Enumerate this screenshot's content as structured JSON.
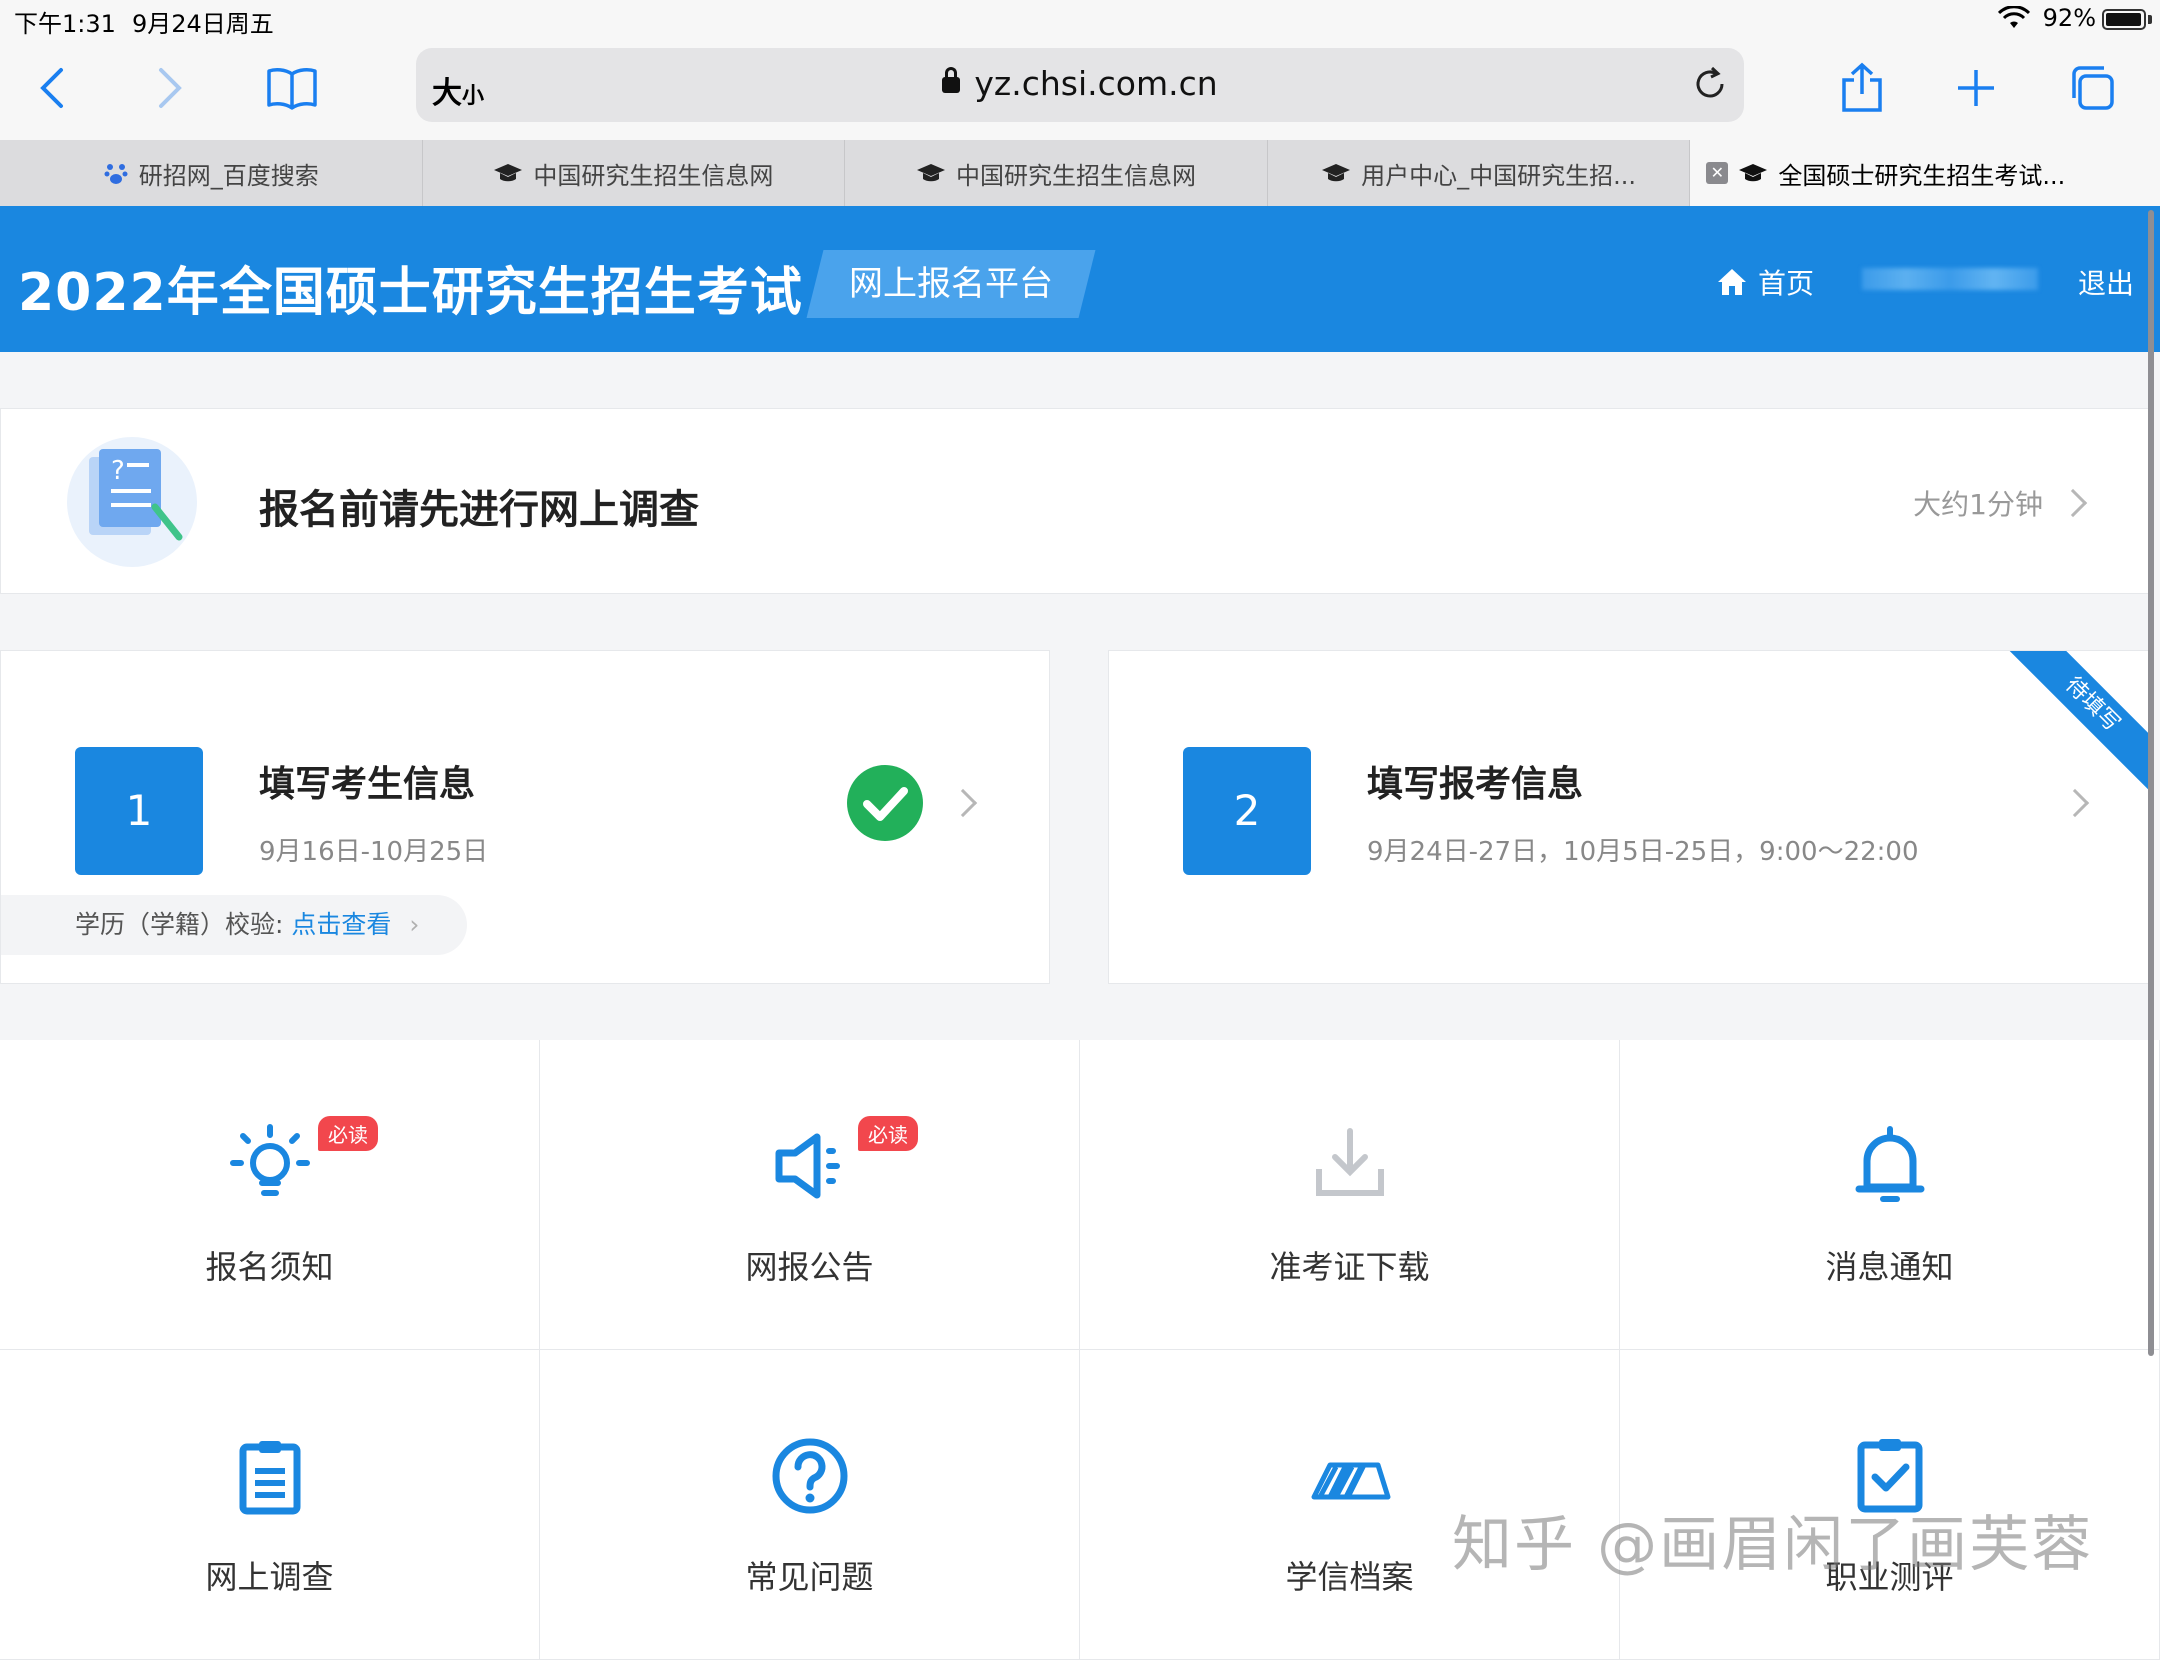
{
  "status_bar": {
    "time": "下午1:31",
    "date": "9月24日周五",
    "battery_percent": "92%"
  },
  "toolbar": {
    "text_size_label": "大",
    "text_size_small": "小",
    "url": "yz.chsi.com.cn"
  },
  "tabs": [
    {
      "title": "研招网_百度搜索",
      "icon": "baidu-icon"
    },
    {
      "title": "中国研究生招生信息网",
      "icon": "mortarboard-icon"
    },
    {
      "title": "中国研究生招生信息网",
      "icon": "mortarboard-icon"
    },
    {
      "title": "用户中心_中国研究生招...",
      "icon": "mortarboard-icon"
    },
    {
      "title": "全国硕士研究生招生考试...",
      "icon": "mortarboard-icon"
    }
  ],
  "header": {
    "title": "2022年全国硕士研究生招生考试",
    "platform": "网上报名平台",
    "home": "首页",
    "logout": "退出",
    "color": "#1a87e0"
  },
  "survey": {
    "title": "报名前请先进行网上调查",
    "duration": "大约1分钟"
  },
  "steps": [
    {
      "number": "1",
      "title": "填写考生信息",
      "dates": "9月16日-10月25日",
      "completed": true,
      "verify_label": "学历（学籍）校验:",
      "verify_link": "点击查看"
    },
    {
      "number": "2",
      "title": "填写报考信息",
      "dates": "9月24日-27日，10月5日-25日，9:00～22:00",
      "ribbon": "待填写"
    }
  ],
  "menu": [
    {
      "label": "报名须知",
      "icon": "lightbulb-icon",
      "badge": "必读"
    },
    {
      "label": "网报公告",
      "icon": "megaphone-icon",
      "badge": "必读"
    },
    {
      "label": "准考证下载",
      "icon": "download-icon"
    },
    {
      "label": "消息通知",
      "icon": "bell-icon"
    },
    {
      "label": "网上调查",
      "icon": "clipboard-icon"
    },
    {
      "label": "常见问题",
      "icon": "question-icon"
    },
    {
      "label": "学信档案",
      "icon": "archive-icon"
    },
    {
      "label": "职业测评",
      "icon": "assessment-icon"
    }
  ],
  "watermark": "知乎 @画眉闲了画芙蓉"
}
